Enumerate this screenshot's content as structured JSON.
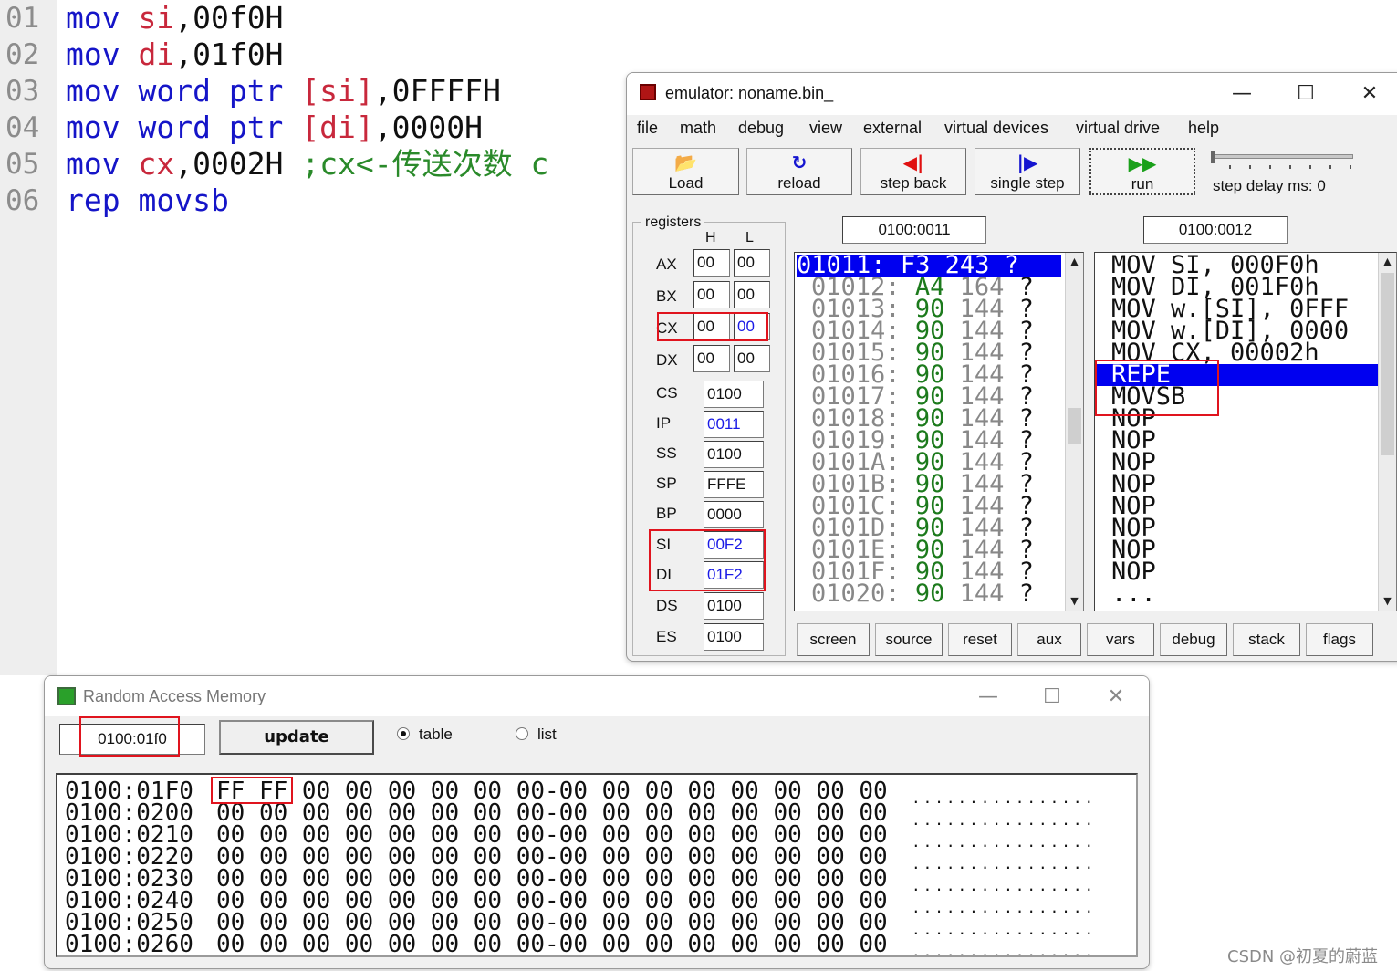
{
  "editor": {
    "line_numbers": [
      "01",
      "02",
      "03",
      "04",
      "05",
      "06"
    ],
    "lines": [
      {
        "kw": "mov",
        "a": "si",
        "b": ",00f0H",
        "c": "",
        "comment": ""
      },
      {
        "kw": "mov",
        "a": "di",
        "b": ",01f0H",
        "c": "",
        "comment": ""
      },
      {
        "kw": "mov",
        "a": "word ptr",
        "b": " ",
        "c": "[si]",
        "d": ",0FFFFH",
        "comment": ""
      },
      {
        "kw": "mov",
        "a": "word ptr",
        "b": " ",
        "c": "[di]",
        "d": ",0000H",
        "comment": ""
      },
      {
        "kw": "mov",
        "a": "cx",
        "b": ",0002H",
        "c": "",
        "comment": ";cx<-传送次数 c"
      },
      {
        "kw": "rep",
        "a": "movsb",
        "b": "",
        "c": "",
        "comment": ""
      }
    ]
  },
  "emulator": {
    "title": "emulator: noname.bin_",
    "window_controls": {
      "minimize": "—",
      "maximize": "☐",
      "close": "✕"
    },
    "menu": [
      "file",
      "math",
      "debug",
      "view",
      "external",
      "virtual devices",
      "virtual drive",
      "help"
    ],
    "toolbar": [
      {
        "label": "Load",
        "icon": "open-folder-icon",
        "glyph": "📂"
      },
      {
        "label": "reload",
        "icon": "reload-icon",
        "glyph": "↻"
      },
      {
        "label": "step back",
        "icon": "step-back-icon",
        "glyph": "◀|"
      },
      {
        "label": "single step",
        "icon": "single-step-icon",
        "glyph": "|▶"
      },
      {
        "label": "run",
        "icon": "run-icon",
        "glyph": "▶▶"
      }
    ],
    "step_delay_label": "step delay ms: 0",
    "registers_title": "registers",
    "h_label": "H",
    "l_label": "L",
    "registers_hl": [
      {
        "name": "AX",
        "h": "00",
        "l": "00"
      },
      {
        "name": "BX",
        "h": "00",
        "l": "00"
      },
      {
        "name": "CX",
        "h": "00",
        "l": "00"
      },
      {
        "name": "DX",
        "h": "00",
        "l": "00"
      }
    ],
    "registers_16": [
      {
        "name": "CS",
        "value": "0100"
      },
      {
        "name": "IP",
        "value": "0011"
      },
      {
        "name": "SS",
        "value": "0100"
      },
      {
        "name": "SP",
        "value": "FFFE"
      },
      {
        "name": "BP",
        "value": "0000"
      },
      {
        "name": "SI",
        "value": "00F2"
      },
      {
        "name": "DI",
        "value": "01F2"
      },
      {
        "name": "DS",
        "value": "0100"
      },
      {
        "name": "ES",
        "value": "0100"
      }
    ],
    "mem_address": "0100:0011",
    "disasm_address": "0100:0012",
    "memory_lines": [
      {
        "addr": "01011:",
        "byte": "F3",
        "dec": "243",
        "ch": "?"
      },
      {
        "addr": "01012:",
        "byte": "A4",
        "dec": "164",
        "ch": "?"
      },
      {
        "addr": "01013:",
        "byte": "90",
        "dec": "144",
        "ch": "?"
      },
      {
        "addr": "01014:",
        "byte": "90",
        "dec": "144",
        "ch": "?"
      },
      {
        "addr": "01015:",
        "byte": "90",
        "dec": "144",
        "ch": "?"
      },
      {
        "addr": "01016:",
        "byte": "90",
        "dec": "144",
        "ch": "?"
      },
      {
        "addr": "01017:",
        "byte": "90",
        "dec": "144",
        "ch": "?"
      },
      {
        "addr": "01018:",
        "byte": "90",
        "dec": "144",
        "ch": "?"
      },
      {
        "addr": "01019:",
        "byte": "90",
        "dec": "144",
        "ch": "?"
      },
      {
        "addr": "0101A:",
        "byte": "90",
        "dec": "144",
        "ch": "?"
      },
      {
        "addr": "0101B:",
        "byte": "90",
        "dec": "144",
        "ch": "?"
      },
      {
        "addr": "0101C:",
        "byte": "90",
        "dec": "144",
        "ch": "?"
      },
      {
        "addr": "0101D:",
        "byte": "90",
        "dec": "144",
        "ch": "?"
      },
      {
        "addr": "0101E:",
        "byte": "90",
        "dec": "144",
        "ch": "?"
      },
      {
        "addr": "0101F:",
        "byte": "90",
        "dec": "144",
        "ch": "?"
      },
      {
        "addr": "01020:",
        "byte": "90",
        "dec": "144",
        "ch": "?"
      }
    ],
    "disasm_lines": [
      "MOV SI, 000F0h",
      "MOV DI, 001F0h",
      "MOV w.[SI], 0FFF",
      "MOV w.[DI], 0000",
      "MOV CX, 00002h",
      "REPE",
      "MOVSB",
      "NOP",
      "NOP",
      "NOP",
      "NOP",
      "NOP",
      "NOP",
      "NOP",
      "NOP",
      "..."
    ],
    "bottom_buttons": [
      "screen",
      "source",
      "reset",
      "aux",
      "vars",
      "debug",
      "stack",
      "flags"
    ]
  },
  "ram": {
    "title": "Random Access Memory",
    "address": "0100:01f0",
    "update_label": "update",
    "radio_table": "table",
    "radio_list": "list",
    "view_mode": "table",
    "rows": [
      {
        "addr": "0100:01F0",
        "bytes": "FF FF 00 00 00 00 00 00-00 00 00 00 00 00 00 00"
      },
      {
        "addr": "0100:0200",
        "bytes": "00 00 00 00 00 00 00 00-00 00 00 00 00 00 00 00"
      },
      {
        "addr": "0100:0210",
        "bytes": "00 00 00 00 00 00 00 00-00 00 00 00 00 00 00 00"
      },
      {
        "addr": "0100:0220",
        "bytes": "00 00 00 00 00 00 00 00-00 00 00 00 00 00 00 00"
      },
      {
        "addr": "0100:0230",
        "bytes": "00 00 00 00 00 00 00 00-00 00 00 00 00 00 00 00"
      },
      {
        "addr": "0100:0240",
        "bytes": "00 00 00 00 00 00 00 00-00 00 00 00 00 00 00 00"
      },
      {
        "addr": "0100:0250",
        "bytes": "00 00 00 00 00 00 00 00-00 00 00 00 00 00 00 00"
      },
      {
        "addr": "0100:0260",
        "bytes": "00 00 00 00 00 00 00 00-00 00 00 00 00 00 00 00"
      }
    ],
    "ascii_dots": "................"
  },
  "watermark": "CSDN @初夏的蔚蓝"
}
